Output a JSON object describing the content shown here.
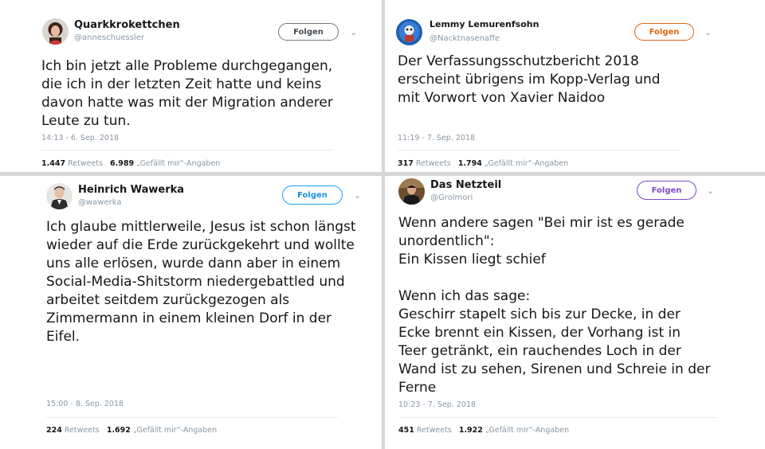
{
  "tweets": [
    {
      "name": "Quarkkrokettchen",
      "handle": "@anneschuessler",
      "follow": "Folgen",
      "follow_color": "#555e66",
      "text": "Ich bin jetzt alle Probleme durchgegangen,\ndie ich in der letzten Zeit hatte und keins\ndavon hatte was mit der Migration anderer\nLeute zu tun.",
      "time": "14:13 - 6. Sep. 2018",
      "retweets": "1.447",
      "retweets_label": "Retweets",
      "likes": "6.989",
      "likes_label": "„Gefällt mir“-Angaben",
      "avatar": "woman-avatar"
    },
    {
      "name": "Lemmy Lemurenfsohn",
      "handle": "@Nacktnasenaffe",
      "follow": "Folgen",
      "follow_color": "#e0650b",
      "text": "Der Verfassungsschutzbericht 2018\nerscheint übrigens im Kopp-Verlag und\nmit Vorwort von Xavier Naidoo",
      "time": "11:19 - 7. Sep. 2018",
      "retweets": "317",
      "retweets_label": "Retweets",
      "likes": "1.794",
      "likes_label": "„Gefällt mir“-Angaben",
      "avatar": "cartoon-avatar"
    },
    {
      "name": "Heinrich Wawerka",
      "handle": "@wawerka",
      "follow": "Folgen",
      "follow_color": "#1da1f2",
      "text": "Ich glaube mittlerweile, Jesus ist schon längst\nwieder auf die Erde zurückgekehrt und wollte\nuns alle erlösen, wurde dann aber in einem\nSocial-Media-Shitstorm niedergebattled und\narbeitet seitdem zurückgezogen als\nZimmermann in einem kleinen Dorf in der\nEifel.",
      "time": "15:00 - 8. Sep. 2018",
      "retweets": "224",
      "retweets_label": "Retweets",
      "likes": "1.692",
      "likes_label": "„Gefällt mir“-Angaben",
      "avatar": "man-avatar"
    },
    {
      "name": "Das Netzteil",
      "handle": "@Grolmori",
      "follow": "Folgen",
      "follow_color": "#794bc4",
      "text": "Wenn andere sagen \"Bei mir ist es gerade\nunordentlich\":\nEin Kissen liegt schief\n\nWenn ich das sage:\nGeschirr stapelt sich bis zur Decke, in der\nEcke brennt ein Kissen, der Vorhang ist in\nTeer getränkt, ein rauchendes Loch in der\nWand ist zu sehen, Sirenen und Schreie in der\nFerne",
      "time": "10:23 - 7. Sep. 2018",
      "retweets": "451",
      "retweets_label": "Retweets",
      "likes": "1.922",
      "likes_label": "„Gefällt mir“-Angaben",
      "avatar": "person-avatar"
    }
  ]
}
